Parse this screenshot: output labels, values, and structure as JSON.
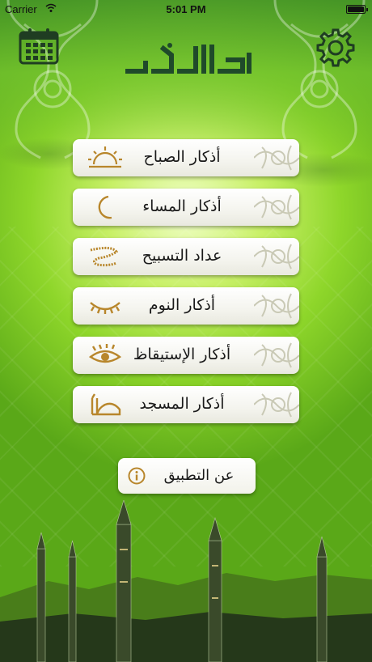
{
  "status_bar": {
    "carrier": "Carrier",
    "time": "5:01 PM"
  },
  "header": {
    "calendar_icon": "calendar-icon",
    "settings_icon": "gear-icon",
    "logo_text": "ذكر الله"
  },
  "menu": {
    "items": [
      {
        "label": "أذكار الصباح",
        "icon": "sunrise-icon"
      },
      {
        "label": "أذكار المساء",
        "icon": "crescent-moon-icon"
      },
      {
        "label": "عداد التسبيح",
        "icon": "prayer-beads-icon"
      },
      {
        "label": "أذكار النوم",
        "icon": "closed-eye-icon"
      },
      {
        "label": "أذكار الإستيقاظ",
        "icon": "open-eye-icon"
      },
      {
        "label": "أذكار المسجد",
        "icon": "mosque-icon"
      }
    ],
    "about_label": "عن التطبيق",
    "about_icon": "info-icon"
  },
  "colors": {
    "accent_gold": "#b8862b",
    "logo_dark_green": "#1f4a2a",
    "button_text": "#1a1a1a"
  }
}
